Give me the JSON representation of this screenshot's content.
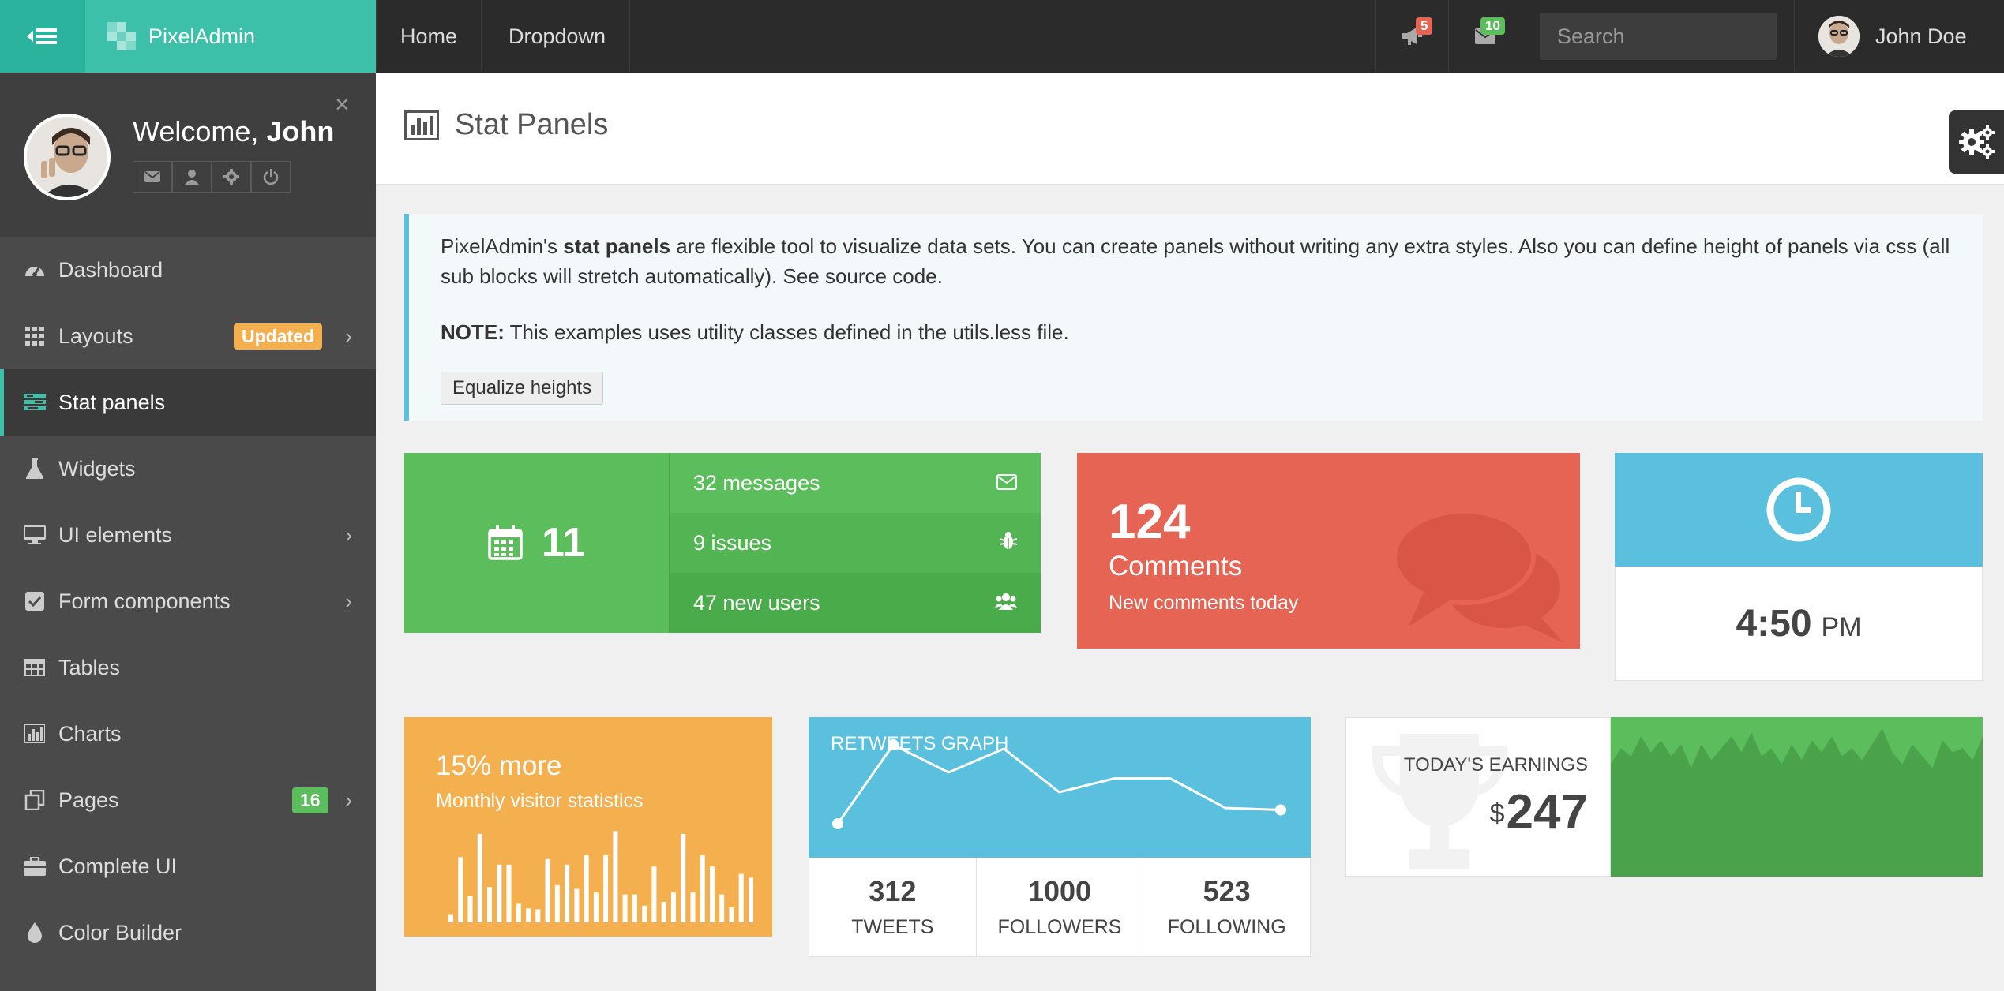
{
  "app": {
    "brand": "PixelAdmin"
  },
  "topnav": {
    "links": [
      "Home",
      "Dropdown"
    ],
    "notifications_count": "5",
    "messages_count": "10",
    "search_placeholder": "Search",
    "user_name": "John Doe"
  },
  "sidebar": {
    "welcome_prefix": "Welcome, ",
    "welcome_name": "John",
    "items": [
      {
        "label": "Dashboard",
        "icon": "dashboard-icon"
      },
      {
        "label": "Layouts",
        "icon": "grid-icon",
        "badge": "Updated",
        "has_submenu": true
      },
      {
        "label": "Stat panels",
        "icon": "tasks-icon",
        "active": true
      },
      {
        "label": "Widgets",
        "icon": "flask-icon"
      },
      {
        "label": "UI elements",
        "icon": "desktop-icon",
        "has_submenu": true
      },
      {
        "label": "Form components",
        "icon": "check-square-icon",
        "has_submenu": true
      },
      {
        "label": "Tables",
        "icon": "table-icon"
      },
      {
        "label": "Charts",
        "icon": "bar-chart-icon"
      },
      {
        "label": "Pages",
        "icon": "files-icon",
        "badge": "16",
        "has_submenu": true
      },
      {
        "label": "Complete UI",
        "icon": "briefcase-icon"
      },
      {
        "label": "Color Builder",
        "icon": "tint-icon"
      }
    ]
  },
  "page": {
    "title": "Stat Panels",
    "note": {
      "text_pre": "PixelAdmin's ",
      "text_bold": "stat panels",
      "text_post": " are flexible tool to visualize data sets. You can create panels without writing any extra styles. Also you can define height of panels via css (all sub blocks will stretch automatically). See source code.",
      "note_label": "NOTE:",
      "note_text": " This examples uses utility classes defined in the utils.less file.",
      "button": "Equalize heights"
    }
  },
  "panels": {
    "calendar": {
      "value": "11",
      "rows": [
        {
          "label": "32 messages",
          "icon": "envelope-icon"
        },
        {
          "label": "9 issues",
          "icon": "bug-icon"
        },
        {
          "label": "47 new users",
          "icon": "users-icon"
        }
      ]
    },
    "comments": {
      "count": "124",
      "title": "Comments",
      "subtitle": "New comments today"
    },
    "clock": {
      "time": "4:50",
      "ampm": "PM"
    },
    "visitors": {
      "title": "15% more",
      "subtitle": "Monthly visitor statistics",
      "bars": [
        0.08,
        0.7,
        0.28,
        0.95,
        0.38,
        0.62,
        0.62,
        0.2,
        0.15,
        0.14,
        0.68,
        0.4,
        0.62,
        0.36,
        0.72,
        0.32,
        0.72,
        0.98,
        0.3,
        0.3,
        0.18,
        0.6,
        0.22,
        0.32,
        0.95,
        0.32,
        0.72,
        0.6,
        0.3,
        0.16,
        0.52,
        0.48
      ]
    },
    "retweets": {
      "label": "RETWEETS GRAPH",
      "points": [
        1,
        5,
        3.6,
        4.8,
        2.6,
        3.3,
        3.3,
        1.8,
        1.7
      ],
      "stats": [
        {
          "value": "312",
          "label": "TWEETS"
        },
        {
          "value": "1000",
          "label": "FOLLOWERS"
        },
        {
          "value": "523",
          "label": "FOLLOWING"
        }
      ]
    },
    "earnings": {
      "label": "TODAY'S EARNINGS",
      "currency": "$",
      "value": "247",
      "series": [
        0.55,
        0.35,
        0.45,
        0.2,
        0.4,
        0.25,
        0.45,
        0.3,
        0.6,
        0.3,
        0.5,
        0.35,
        0.2,
        0.4,
        0.15,
        0.45,
        0.35,
        0.55,
        0.3,
        0.5,
        0.25,
        0.4,
        0.2,
        0.45,
        0.35,
        0.5,
        0.3,
        0.1,
        0.4,
        0.55,
        0.3,
        0.45,
        0.6,
        0.25,
        0.4,
        0.35,
        0.5,
        0.2
      ]
    }
  },
  "colors": {
    "teal": "#3cc0a9",
    "green": "#5cbd5c",
    "red": "#e66454",
    "blue": "#5bc0de",
    "orange": "#f4b04f",
    "badge_orange": "#f4b04f",
    "badge_red": "#e66454",
    "badge_green": "#5cbd5c"
  }
}
